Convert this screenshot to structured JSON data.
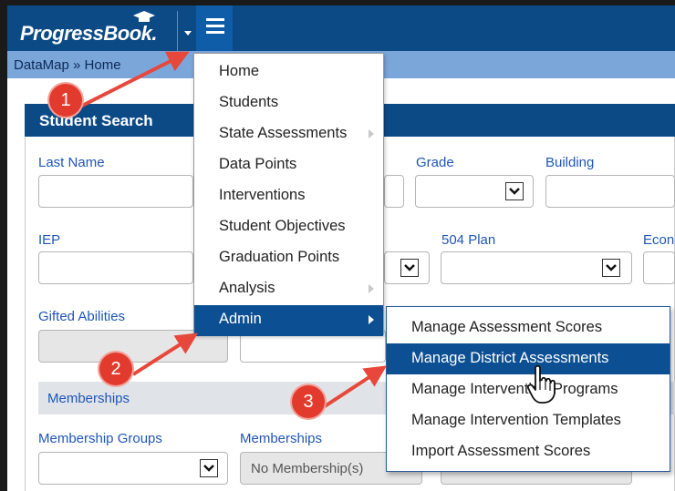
{
  "app": {
    "logo": "ProgressBook."
  },
  "breadcrumb": {
    "text": "DataMap » Home"
  },
  "panel": {
    "title": "Student Search"
  },
  "fields": {
    "last_name": "Last Name",
    "grade": "Grade",
    "building": "Building",
    "iep": "IEP",
    "plan_504": "504 Plan",
    "eco": "Econ",
    "gifted": "Gifted Abilities",
    "memberships_section": "Memberships",
    "membership_groups": "Membership Groups",
    "memberships": "Memberships",
    "memberships_value": "No Membership(s)"
  },
  "menu": {
    "items": [
      {
        "label": "Home"
      },
      {
        "label": "Students"
      },
      {
        "label": "State Assessments"
      },
      {
        "label": "Data Points"
      },
      {
        "label": "Interventions"
      },
      {
        "label": "Student Objectives"
      },
      {
        "label": "Graduation Points"
      },
      {
        "label": "Analysis"
      },
      {
        "label": "Admin"
      }
    ]
  },
  "submenu": {
    "items": [
      {
        "label": "Manage Assessment Scores"
      },
      {
        "label": "Manage District Assessments"
      },
      {
        "label": "Manage Intervention Programs"
      },
      {
        "label": "Manage Intervention Templates"
      },
      {
        "label": "Import Assessment Scores"
      }
    ]
  },
  "callouts": {
    "one": "1",
    "two": "2",
    "three": "3"
  },
  "colors": {
    "header": "#0c4a86",
    "breadcrumb": "#7ba6da",
    "menu_active": "#0d4f93",
    "callout": "#e23b2e",
    "label": "#1f56b8"
  }
}
